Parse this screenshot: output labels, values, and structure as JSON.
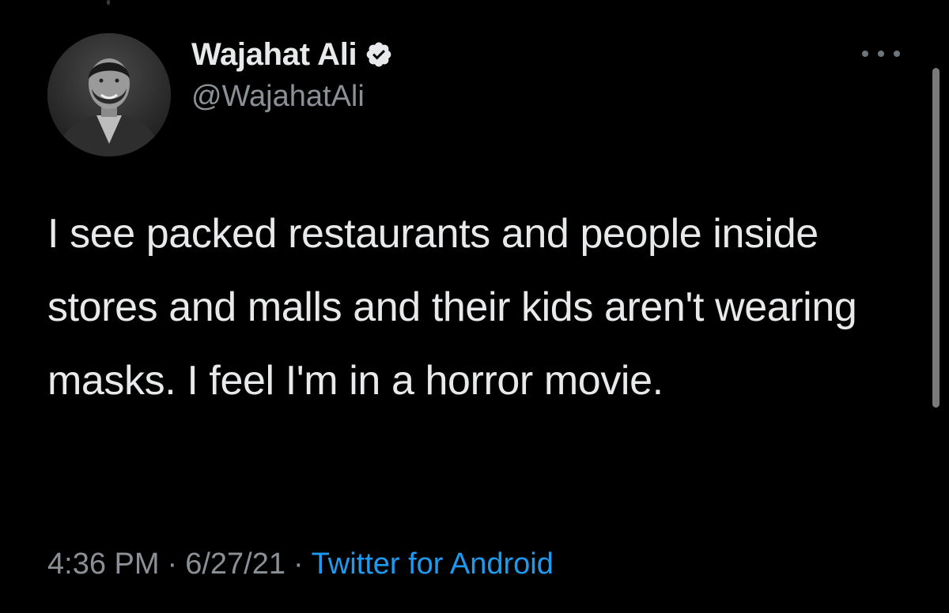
{
  "author": {
    "display_name": "Wajahat Ali",
    "handle": "@WajahatAli",
    "verified": true,
    "avatar_icon": "profile-photo"
  },
  "tweet": {
    "text": "I see packed restaurants and people inside stores and malls and their kids aren't wearing masks. I feel I'm in a horror movie."
  },
  "meta": {
    "time": "4:36 PM",
    "separator": "·",
    "date": "6/27/21",
    "source": "Twitter for Android"
  },
  "icons": {
    "more": "more-options-icon",
    "verified": "verified-badge-icon"
  },
  "colors": {
    "background": "#000000",
    "text": "#e7e9ea",
    "secondary_text": "#8b9096",
    "link": "#1d9bf0",
    "verified_badge": "#e7e9ea"
  }
}
